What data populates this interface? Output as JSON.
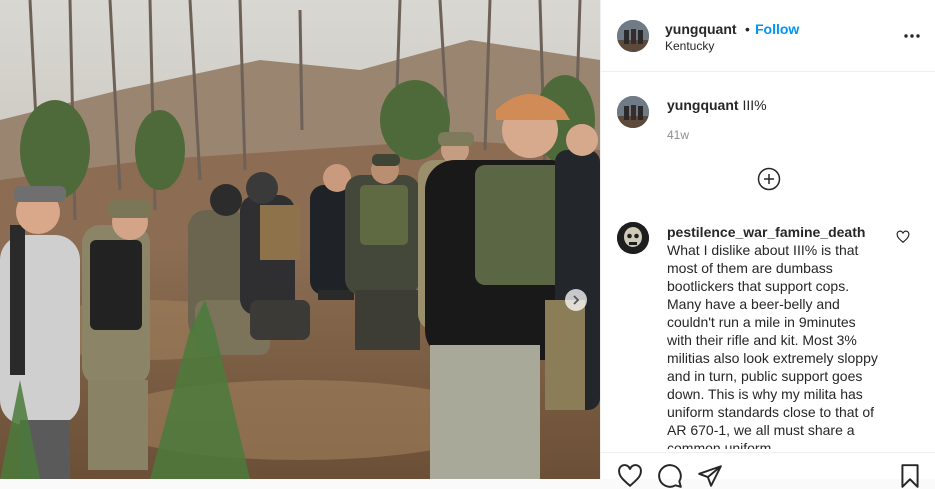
{
  "post": {
    "author": {
      "username": "yungquant",
      "location": "Kentucky",
      "follow_label": "Follow",
      "separator": "•"
    },
    "caption": {
      "username": "yungquant",
      "text": "III%",
      "age": "41w"
    },
    "comments": [
      {
        "username": "pestilence_war_famine_death",
        "text": "What I dislike about III% is that most of them are dumbass bootlickers that support cops. Many have a beer-belly and couldn't run a mile in 9minutes with their rifle and kit. Most 3% militias also look extremely sloppy and in turn, public support goes down. This is why my milita has uniform standards close to that of AR 670-1, we all must share a common uniform"
      }
    ],
    "icons": {
      "more": "more-options-icon",
      "load_more": "plus-circle-icon",
      "like_comment": "heart-outline-icon",
      "like": "heart-outline-icon",
      "comment": "comment-bubble-icon",
      "share": "paper-plane-icon",
      "save": "bookmark-icon",
      "next": "chevron-right-icon"
    },
    "colors": {
      "follow": "#0095f6",
      "text": "#262626",
      "muted": "#8e8e8e"
    }
  }
}
